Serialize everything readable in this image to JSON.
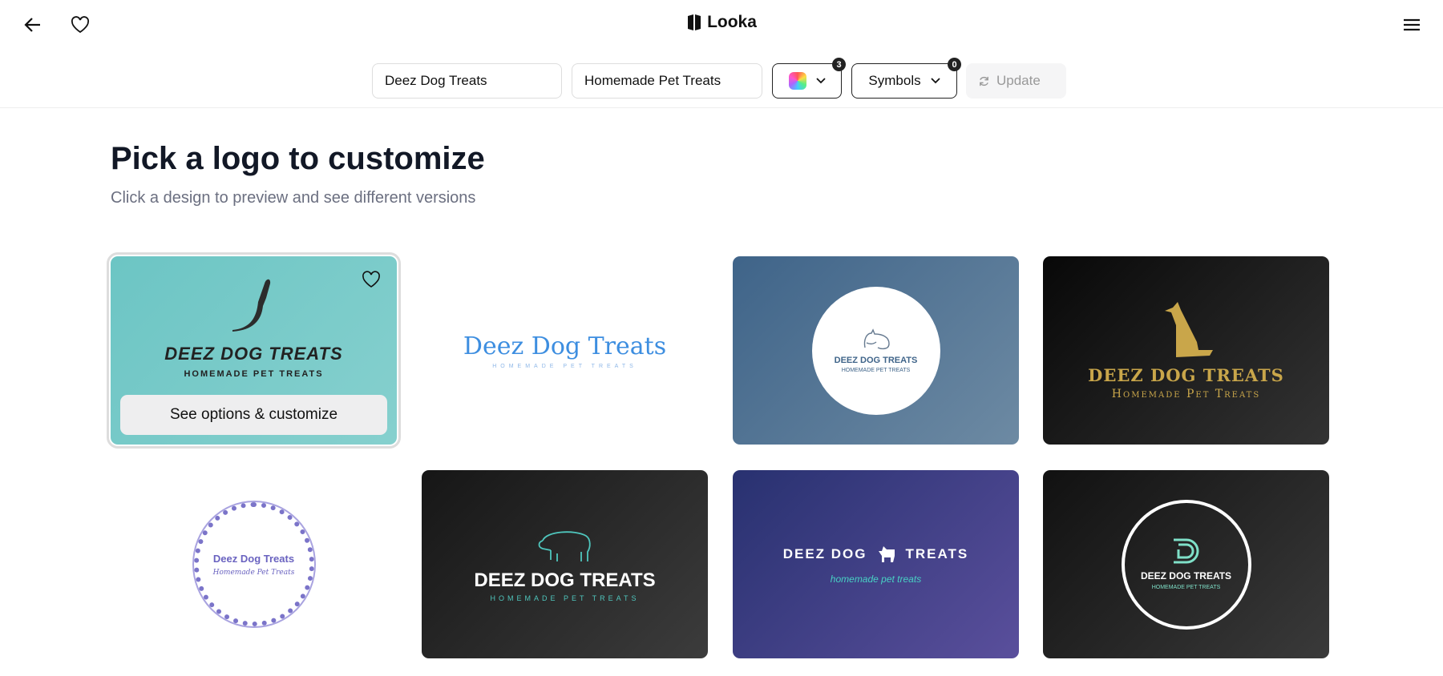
{
  "header": {
    "brand": "Looka"
  },
  "toolbar": {
    "company_name": "Deez Dog Treats",
    "slogan": "Homemade Pet Treats",
    "colors_count": "3",
    "symbols_label": "Symbols",
    "symbols_count": "0",
    "update_label": "Update"
  },
  "main": {
    "title": "Pick a logo to customize",
    "subtitle": "Click a design to preview and see different versions",
    "hover_action": "See options & customize"
  },
  "logos": [
    {
      "name": "DEEZ DOG TREATS",
      "tagline": "HOMEMADE PET TREATS"
    },
    {
      "name": "Deez Dog Treats",
      "tagline": "HOMEMADE PET TREATS"
    },
    {
      "name": "DEEZ DOG TREATS",
      "tagline": "HOMEMADE PET TREATS"
    },
    {
      "name": "DEEZ DOG TREATS",
      "tagline": "Homemade Pet Treats"
    },
    {
      "name": "Deez Dog Treats",
      "tagline": "Homemade Pet Treats"
    },
    {
      "name": "DEEZ DOG TREATS",
      "tagline": "HOMEMADE PET TREATS"
    },
    {
      "name": "DEEZ DOG",
      "name2": "TREATS",
      "tagline": "homemade pet treats"
    },
    {
      "name": "DEEZ DOG TREATS",
      "tagline": "HOMEMADE PET TREATS"
    }
  ]
}
